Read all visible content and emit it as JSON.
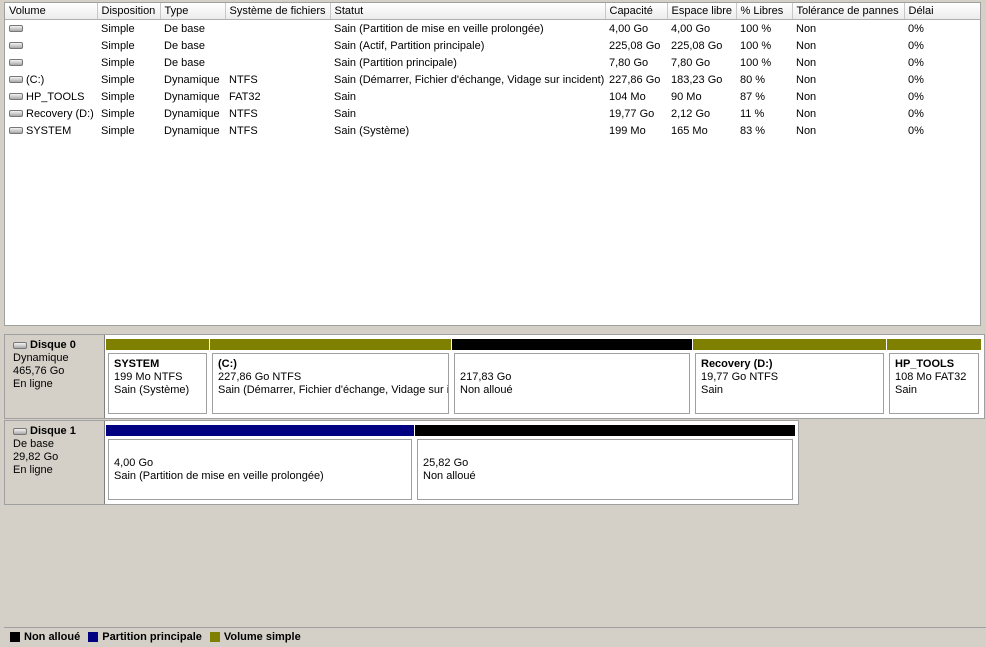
{
  "columns": [
    "Volume",
    "Disposition",
    "Type",
    "Système de fichiers",
    "Statut",
    "Capacité",
    "Espace libre",
    "% Libres",
    "Tolérance de pannes",
    "Délai"
  ],
  "volumes": [
    {
      "volume": "",
      "disposition": "Simple",
      "type": "De base",
      "fs": "",
      "status": "Sain (Partition de mise en veille prolongée)",
      "capacity": "4,00 Go",
      "free": "4,00 Go",
      "pct": "100 %",
      "fault": "Non",
      "delay": "0%"
    },
    {
      "volume": "",
      "disposition": "Simple",
      "type": "De base",
      "fs": "",
      "status": "Sain (Actif, Partition principale)",
      "capacity": "225,08 Go",
      "free": "225,08 Go",
      "pct": "100 %",
      "fault": "Non",
      "delay": "0%"
    },
    {
      "volume": "",
      "disposition": "Simple",
      "type": "De base",
      "fs": "",
      "status": "Sain (Partition principale)",
      "capacity": "7,80 Go",
      "free": "7,80 Go",
      "pct": "100 %",
      "fault": "Non",
      "delay": "0%"
    },
    {
      "volume": "(C:)",
      "disposition": "Simple",
      "type": "Dynamique",
      "fs": "NTFS",
      "status": "Sain (Démarrer, Fichier d'échange, Vidage sur incident)",
      "capacity": "227,86 Go",
      "free": "183,23 Go",
      "pct": "80 %",
      "fault": "Non",
      "delay": "0%"
    },
    {
      "volume": "HP_TOOLS",
      "disposition": "Simple",
      "type": "Dynamique",
      "fs": "FAT32",
      "status": "Sain",
      "capacity": "104 Mo",
      "free": "90 Mo",
      "pct": "87 %",
      "fault": "Non",
      "delay": "0%"
    },
    {
      "volume": "Recovery (D:)",
      "disposition": "Simple",
      "type": "Dynamique",
      "fs": "NTFS",
      "status": "Sain",
      "capacity": "19,77 Go",
      "free": "2,12 Go",
      "pct": "11 %",
      "fault": "Non",
      "delay": "0%"
    },
    {
      "volume": "SYSTEM",
      "disposition": "Simple",
      "type": "Dynamique",
      "fs": "NTFS",
      "status": "Sain (Système)",
      "capacity": "199 Mo",
      "free": "165 Mo",
      "pct": "83 %",
      "fault": "Non",
      "delay": "0%"
    }
  ],
  "disk0": {
    "name": "Disque 0",
    "type": "Dynamique",
    "size": "465,76 Go",
    "state": "En ligne",
    "partitions": [
      {
        "name": "SYSTEM",
        "info": "199 Mo NTFS",
        "status": "Sain (Système)",
        "kind": "simple"
      },
      {
        "name": "(C:)",
        "info": "227,86 Go NTFS",
        "status": "Sain (Démarrer, Fichier d'échange, Vidage sur ir",
        "kind": "simple"
      },
      {
        "name": "",
        "info": "217,83 Go",
        "status": "Non alloué",
        "kind": "unallocated"
      },
      {
        "name": "Recovery  (D:)",
        "info": "19,77 Go NTFS",
        "status": "Sain",
        "kind": "simple"
      },
      {
        "name": "HP_TOOLS",
        "info": "108 Mo FAT32",
        "status": "Sain",
        "kind": "simple"
      }
    ]
  },
  "disk1": {
    "name": "Disque 1",
    "type": "De base",
    "size": "29,82 Go",
    "state": "En ligne",
    "partitions": [
      {
        "name": "",
        "info": "4,00 Go",
        "status": "Sain (Partition de mise en veille prolongée)",
        "kind": "primary"
      },
      {
        "name": "",
        "info": "25,82 Go",
        "status": "Non alloué",
        "kind": "unallocated"
      }
    ]
  },
  "legend": [
    {
      "label": "Non alloué",
      "color": "#000000"
    },
    {
      "label": "Partition principale",
      "color": "#000080"
    },
    {
      "label": "Volume simple",
      "color": "#808000"
    }
  ],
  "colors": {
    "unallocated": "#000000",
    "primary": "#000080",
    "simple": "#808000"
  }
}
